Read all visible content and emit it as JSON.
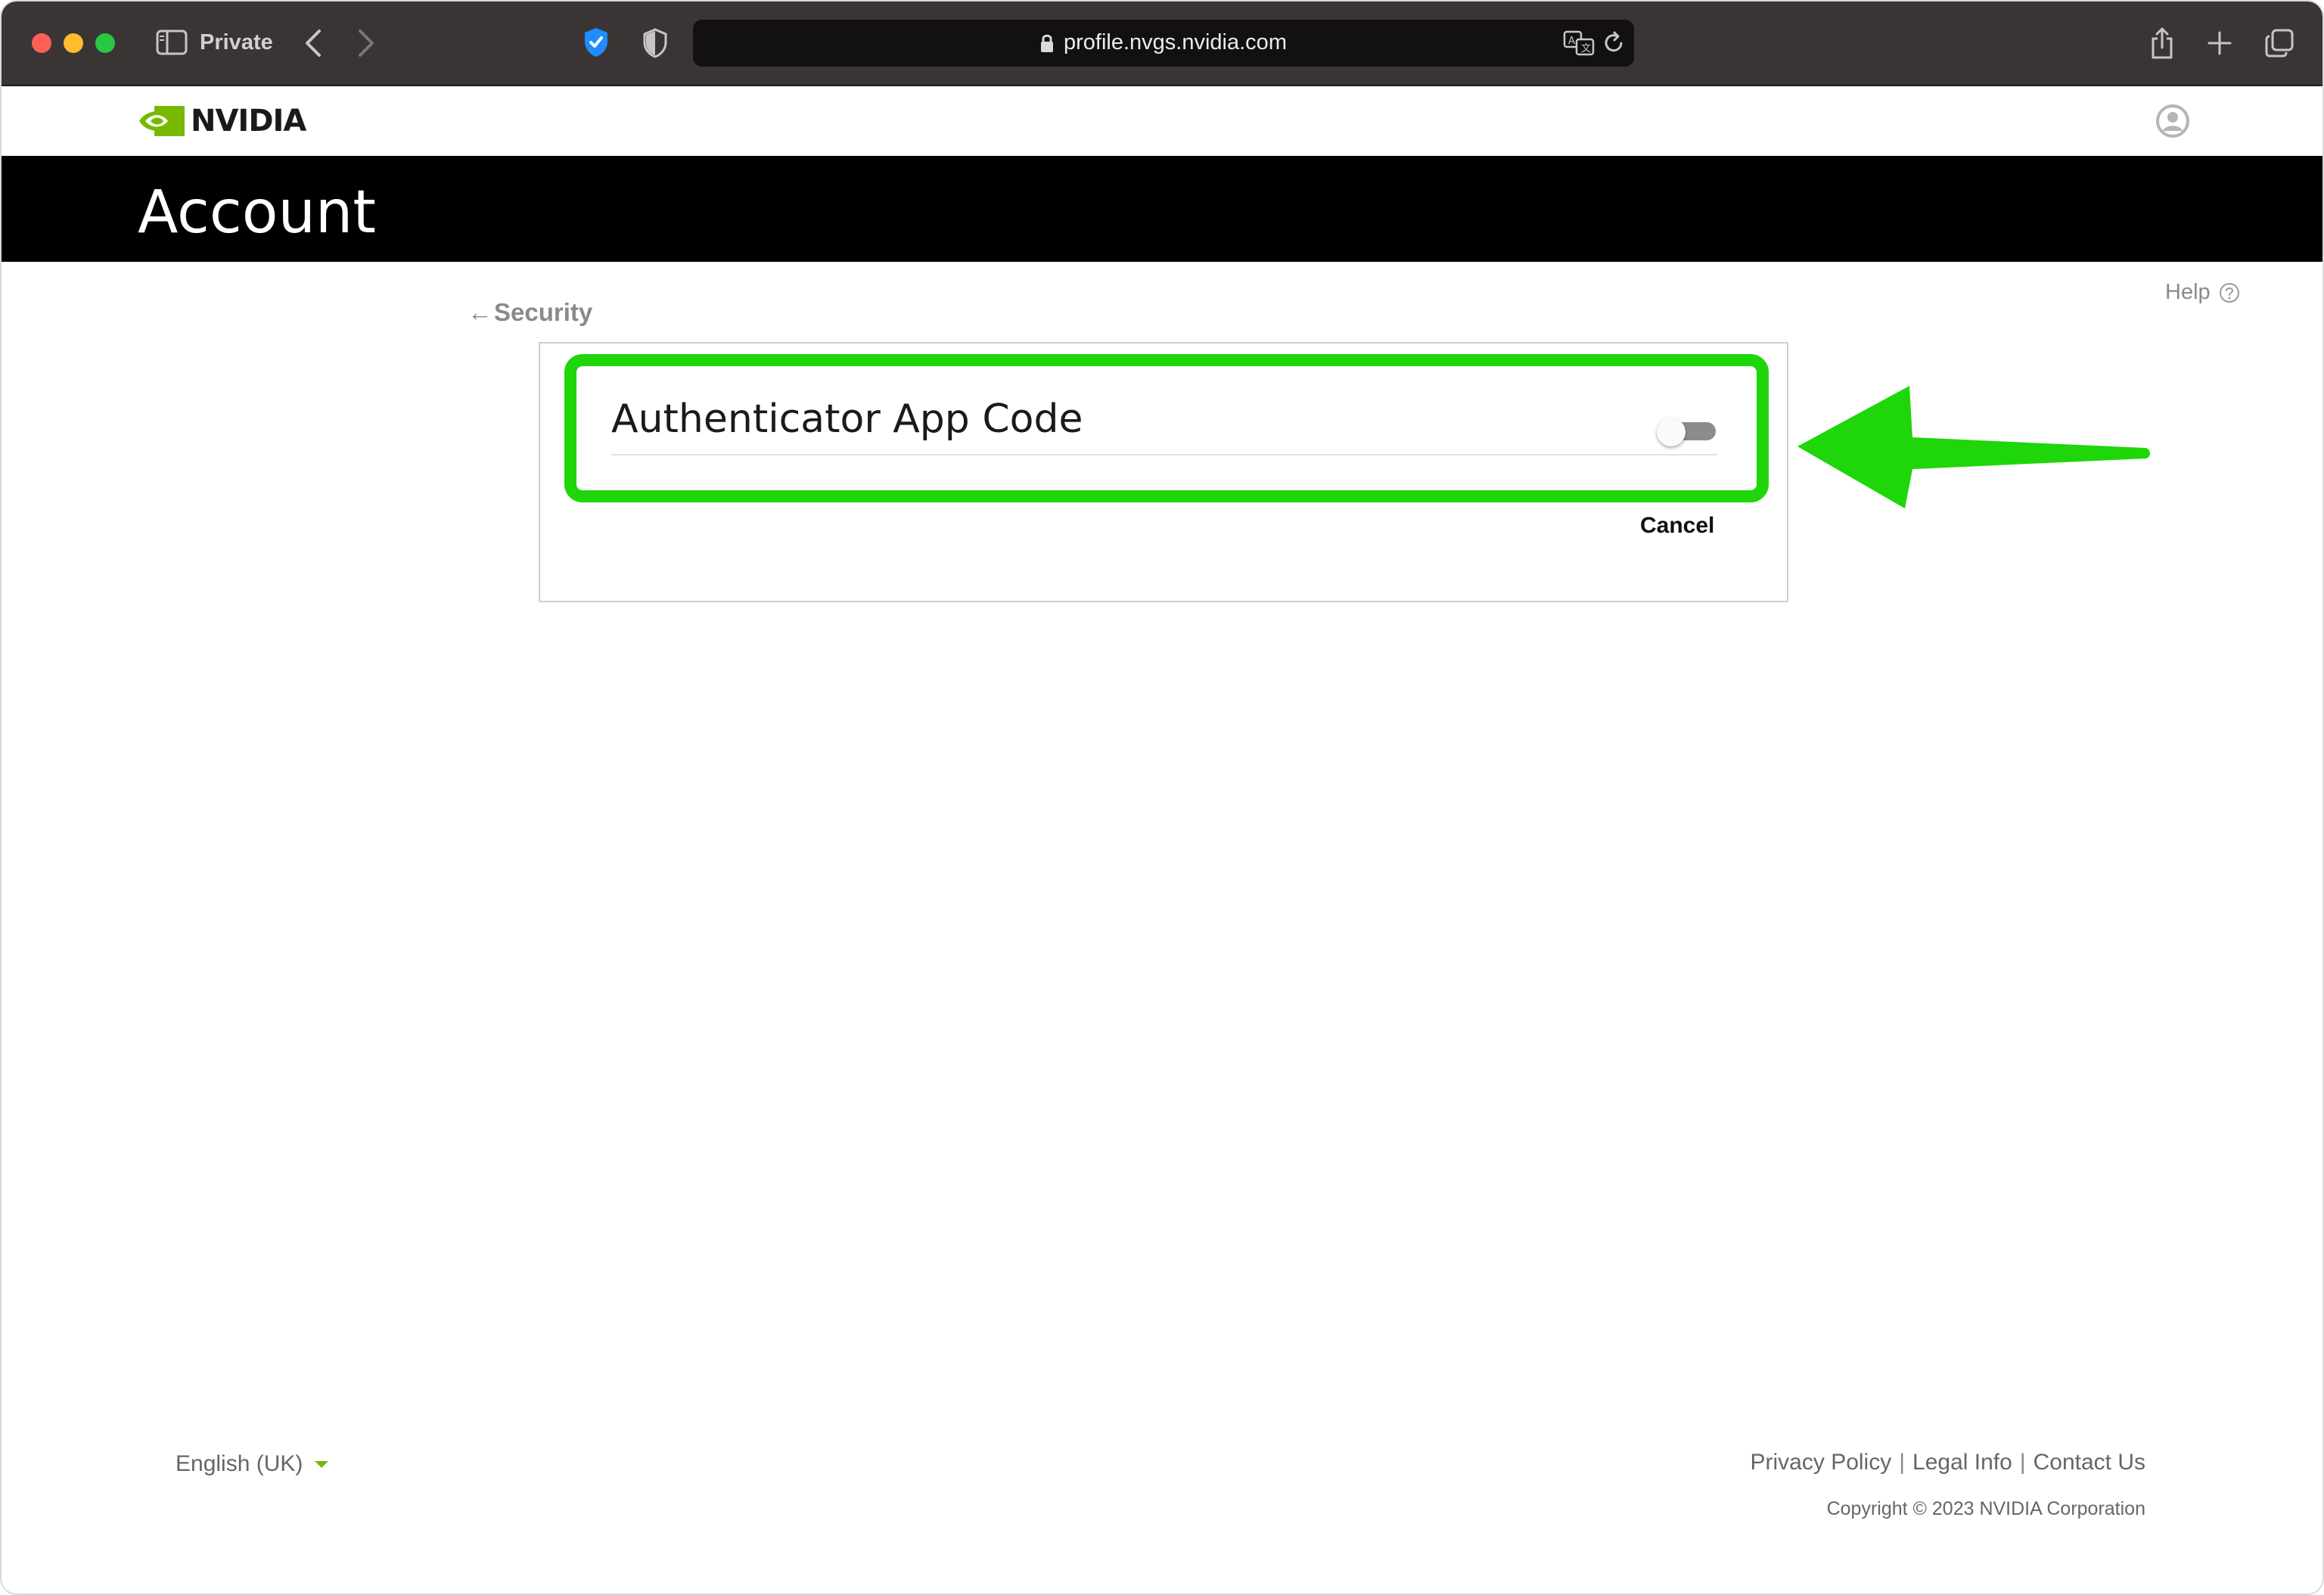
{
  "browser": {
    "private_label": "Private",
    "url": "profile.nvgs.nvidia.com"
  },
  "site": {
    "logo_text": "NVIDIA",
    "brand_color": "#76b900",
    "page_title": "Account",
    "help_label": "Help"
  },
  "breadcrumb": {
    "arrow": "←",
    "label": "Security"
  },
  "auth_card": {
    "title": "Authenticator App Code",
    "toggle_on": false,
    "cancel_label": "Cancel",
    "highlight_color": "#1ed60a"
  },
  "footer": {
    "language": "English (UK)",
    "links": [
      "Privacy Policy",
      "Legal Info",
      "Contact Us"
    ],
    "copyright": "Copyright © 2023 NVIDIA Corporation"
  }
}
